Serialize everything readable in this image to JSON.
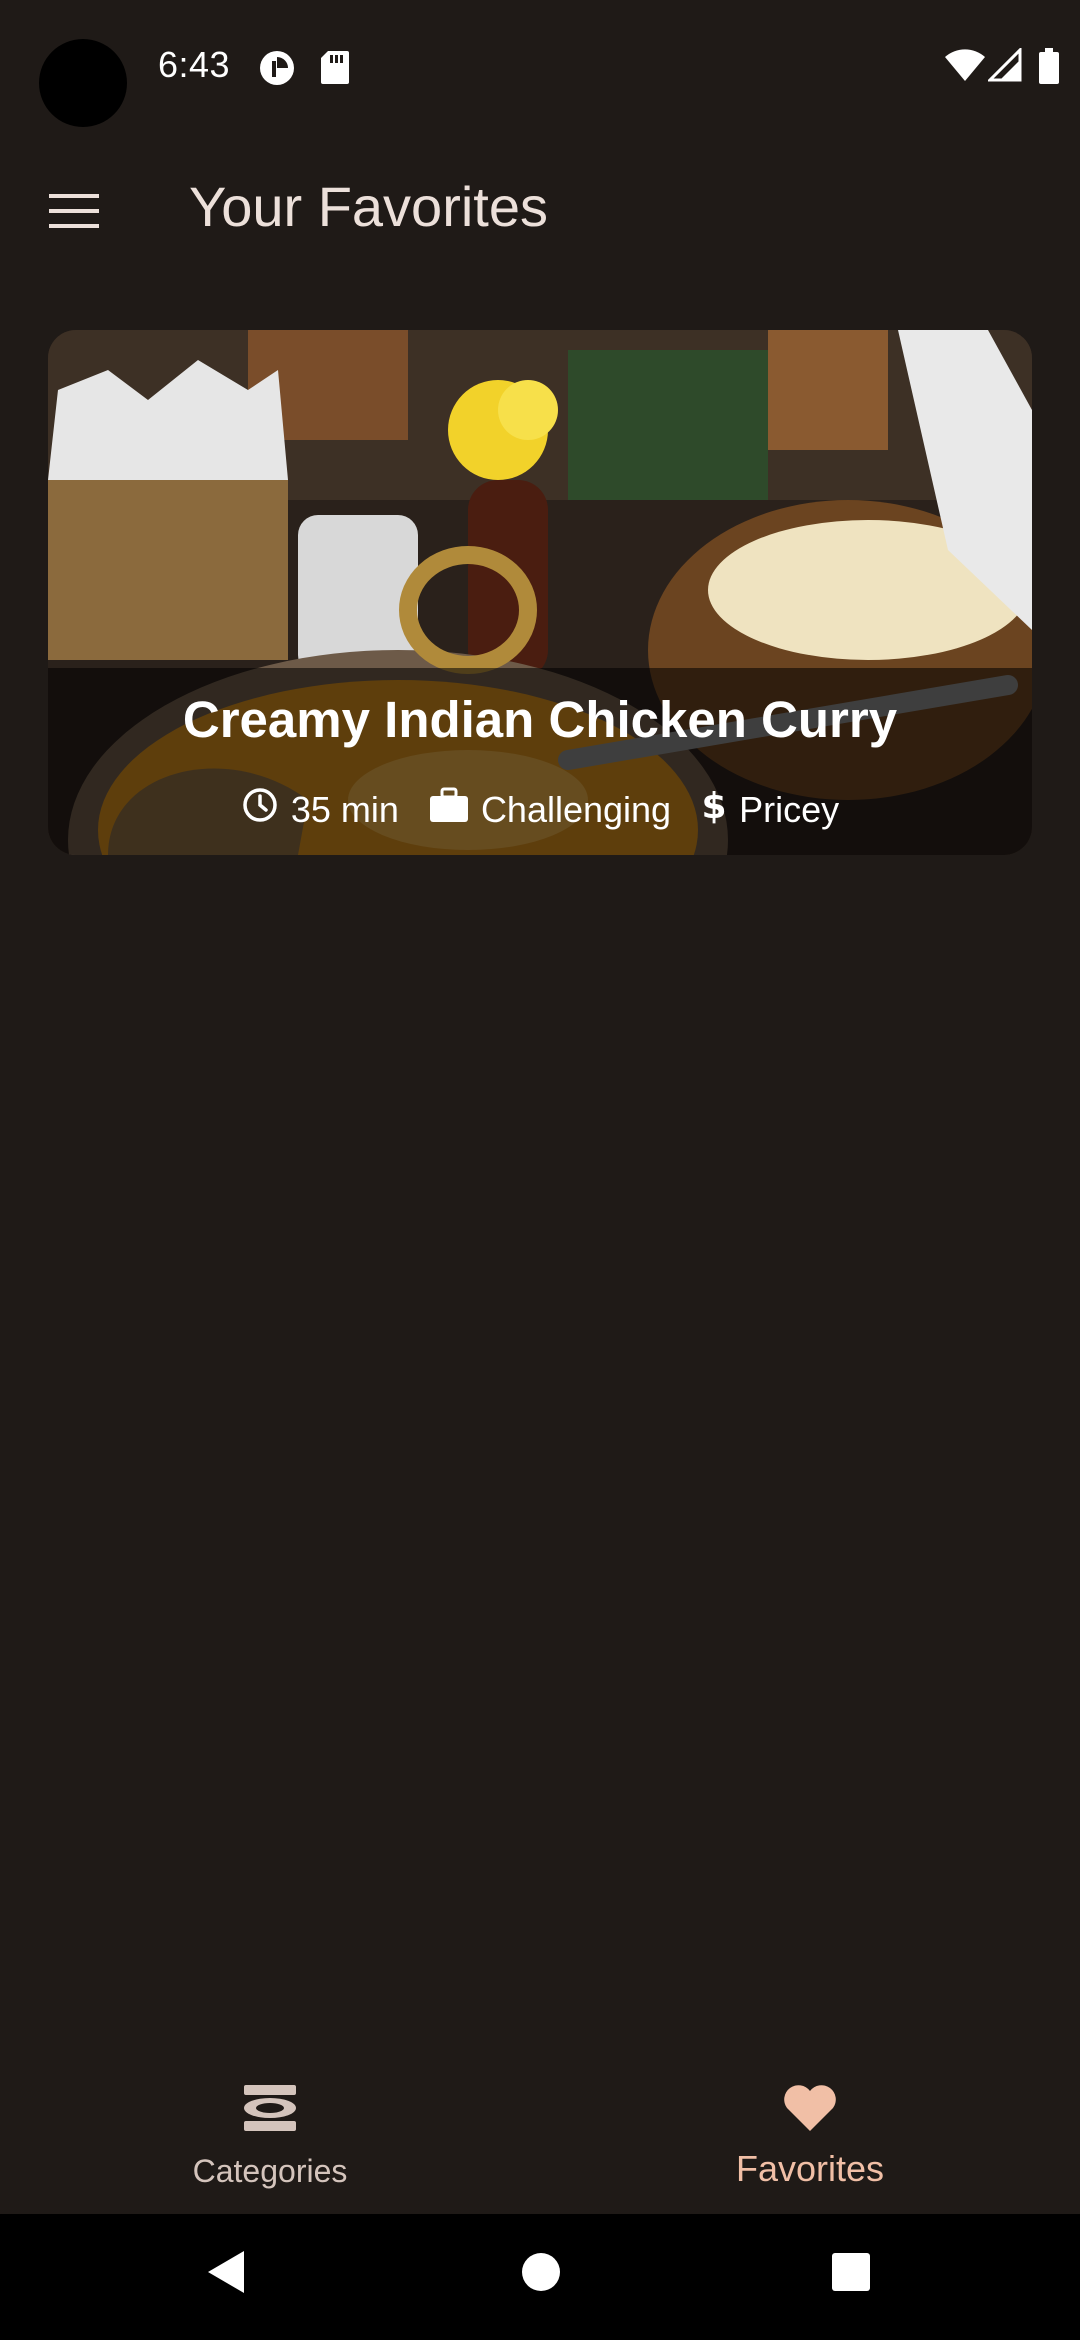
{
  "status_bar": {
    "time": "6:43",
    "left_icons": [
      "data-saver-icon",
      "sd-card-icon"
    ],
    "right_icons": [
      "wifi-icon",
      "cell-signal-icon",
      "battery-icon"
    ]
  },
  "app_bar": {
    "menu_icon": "hamburger-menu-icon",
    "title": "Your Favorites"
  },
  "meals": [
    {
      "title": "Creamy Indian Chicken Curry",
      "duration": "35 min",
      "complexity": "Challenging",
      "affordability": "Pricey"
    }
  ],
  "bottom_nav": {
    "items": [
      {
        "label": "Categories",
        "icon": "dining-set-icon",
        "active": false
      },
      {
        "label": "Favorites",
        "icon": "heart-icon",
        "active": true
      }
    ]
  },
  "colors": {
    "background": "#1f1a17",
    "accent": "#f1bfa6",
    "text": "#ece0da"
  },
  "system_nav": [
    "back",
    "home",
    "recents"
  ]
}
